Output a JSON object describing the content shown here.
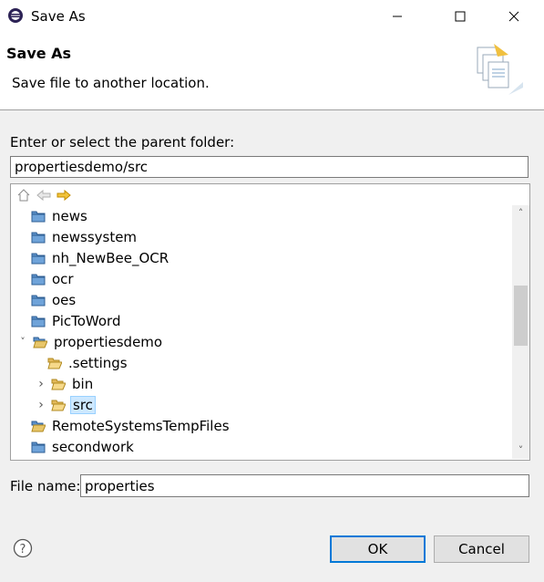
{
  "window": {
    "title": "Save As"
  },
  "header": {
    "title": "Save As",
    "description": "Save file to another location."
  },
  "parent_folder": {
    "label": "Enter or select the parent folder:",
    "value": "propertiesdemo/src"
  },
  "tree": {
    "items": [
      {
        "label": "news",
        "expander": "",
        "type": "project"
      },
      {
        "label": "newssystem",
        "expander": "",
        "type": "project"
      },
      {
        "label": "nh_NewBee_OCR",
        "expander": "",
        "type": "project"
      },
      {
        "label": "ocr",
        "expander": "",
        "type": "project"
      },
      {
        "label": "oes",
        "expander": "",
        "type": "project"
      },
      {
        "label": "PicToWord",
        "expander": "",
        "type": "project"
      },
      {
        "label": "propertiesdemo",
        "expander": "expanded",
        "type": "project-open"
      },
      {
        "label": ".settings",
        "expander": "",
        "type": "folder"
      },
      {
        "label": "bin",
        "expander": "collapsed",
        "type": "folder"
      },
      {
        "label": "src",
        "expander": "collapsed",
        "type": "folder",
        "selected": true
      },
      {
        "label": "RemoteSystemsTempFiles",
        "expander": "",
        "type": "project-open"
      },
      {
        "label": "secondwork",
        "expander": "",
        "type": "project"
      }
    ]
  },
  "file_name": {
    "label": "File name:",
    "value": "properties"
  },
  "buttons": {
    "ok": "OK",
    "cancel": "Cancel"
  },
  "icons": {
    "home": "home-icon",
    "back": "back-arrow-icon",
    "forward": "forward-arrow-icon",
    "help": "help-icon"
  }
}
